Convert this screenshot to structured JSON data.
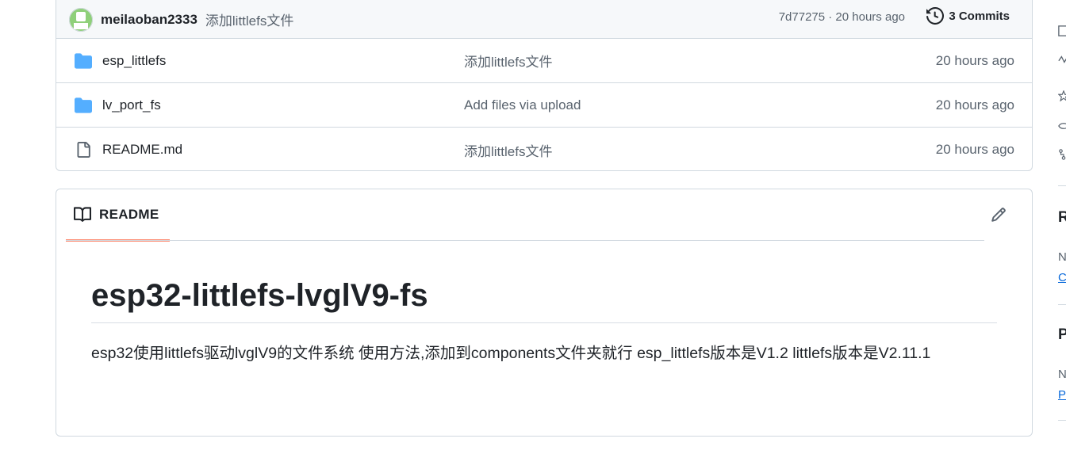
{
  "commit_bar": {
    "author": "meilaoban2333",
    "message": "添加littlefs文件",
    "meta": "7d77275 · 20 hours ago",
    "commits_label": "3 Commits"
  },
  "files": [
    {
      "type": "folder",
      "name": "esp_littlefs",
      "message": "添加littlefs文件",
      "age": "20 hours ago"
    },
    {
      "type": "folder",
      "name": "lv_port_fs",
      "message": "Add files via upload",
      "age": "20 hours ago"
    },
    {
      "type": "file",
      "name": "README.md",
      "message": "添加littlefs文件",
      "age": "20 hours ago"
    }
  ],
  "readme": {
    "tab_label": "README",
    "title": "esp32-littlefs-lvglV9-fs",
    "description": "esp32使用littlefs驱动lvglV9的文件系统 使用方法,添加到components文件夹就行 esp_littlefs版本是V1.2 littlefs版本是V2.11.1"
  },
  "sidebar": {
    "heading_1": "R",
    "text_1": "N",
    "link_1": "C",
    "heading_2": "P",
    "text_2": "N",
    "link_2": "P"
  },
  "colors": {
    "folder": "#54aeff",
    "tab_underline": "#fd8c73",
    "link": "#0969da",
    "border": "#d1d9e0"
  }
}
